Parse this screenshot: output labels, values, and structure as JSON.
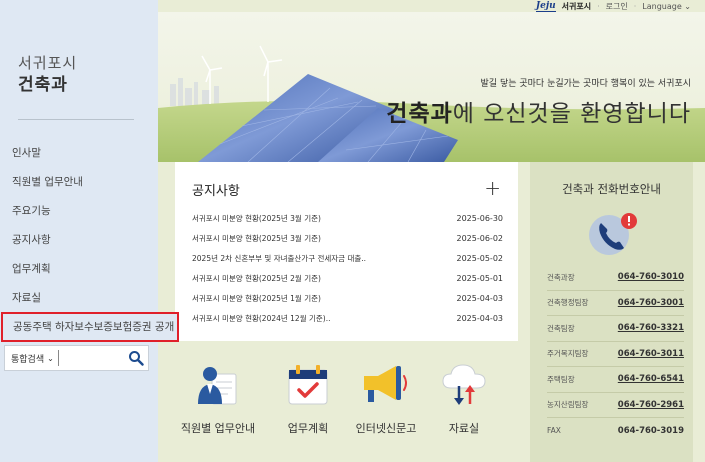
{
  "topbar": {
    "logo": "Jeju",
    "logo_kr": "서귀포시",
    "login": "로그인",
    "language": "Language"
  },
  "sidebar": {
    "site_sub": "서귀포시",
    "site_title": "건축과",
    "items": [
      {
        "label": "인사말"
      },
      {
        "label": "직원별 업무안내"
      },
      {
        "label": "주요기능"
      },
      {
        "label": "공지사항"
      },
      {
        "label": "업무계획"
      },
      {
        "label": "자료실"
      },
      {
        "label": "공동주택 하자보수보증보험증권 공개"
      }
    ],
    "search": {
      "select_label": "통합검색",
      "placeholder": ""
    }
  },
  "hero": {
    "tagline": "발길 닿는 곳마다 눈길가는 곳마다 행복이 있는 서귀포시",
    "title_bold": "건축과",
    "title_rest": "에 오신것을 환영합니다"
  },
  "notice": {
    "title": "공지사항",
    "more": "+",
    "rows": [
      {
        "title": "서귀포시 미분양 현황(2025년 3월 기준)",
        "date": "2025-06-30"
      },
      {
        "title": "서귀포시 미분양 현황(2025년 3월 기준)",
        "date": "2025-06-02"
      },
      {
        "title": "2025년 2차 신혼부부 및 자녀출산가구 전세자금 대출..",
        "date": "2025-05-02"
      },
      {
        "title": "서귀포시 미분양 현황(2025년 2월 기준)",
        "date": "2025-05-01"
      },
      {
        "title": "서귀포시 미분양 현황(2025년 1월 기준)",
        "date": "2025-04-03"
      },
      {
        "title": "서귀포시 미분양 현황(2024년 12월 기준)..",
        "date": "2025-04-03"
      }
    ]
  },
  "phone": {
    "title": "건축과 전화번호안내",
    "rows": [
      {
        "name": "건축과장",
        "number": "064-760-3010"
      },
      {
        "name": "건축행정팀장",
        "number": "064-760-3001"
      },
      {
        "name": "건축팀장",
        "number": "064-760-3321"
      },
      {
        "name": "주거복지팀장",
        "number": "064-760-3011"
      },
      {
        "name": "주택팀장",
        "number": "064-760-6541"
      },
      {
        "name": "농지산림팀장",
        "number": "064-760-2961"
      },
      {
        "name": "FAX",
        "number": "064-760-3019"
      }
    ]
  },
  "quick": [
    {
      "label": "직원별 업무안내",
      "icon": "staff-icon"
    },
    {
      "label": "업무계획",
      "icon": "calendar-check-icon"
    },
    {
      "label": "인터넷신문고",
      "icon": "megaphone-icon"
    },
    {
      "label": "자료실",
      "icon": "cloud-download-icon"
    }
  ]
}
